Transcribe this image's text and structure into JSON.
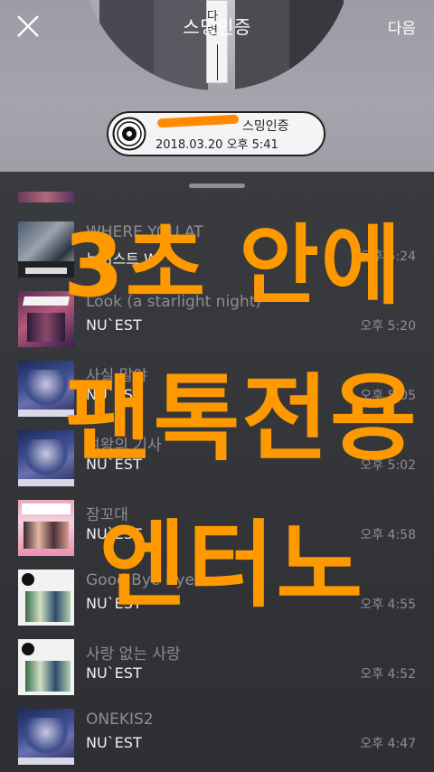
{
  "header": {
    "title": "스밍인증",
    "next_label": "다음",
    "close_icon": "close-icon",
    "cover_banner_text": "다 변"
  },
  "certificate": {
    "icon": "disc-icon",
    "name_suffix": "스밍인증",
    "datetime": "2018.03.20 오후 5:41",
    "redaction_color": "#ff8a00"
  },
  "songs": [
    {
      "title": "WHERE YOU AT",
      "artist": "뉴이스트 W",
      "time": "오후 5:24",
      "art": "art-where"
    },
    {
      "title": "Look (a starlight night)",
      "artist": "NU`EST",
      "time": "오후 5:20",
      "art": "art-nuest"
    },
    {
      "title": "사실 말야",
      "artist": "NU`EST",
      "time": "오후 5:05",
      "art": "art-blue"
    },
    {
      "title": "여왕의 기사",
      "artist": "NU`EST",
      "time": "오후 5:02",
      "art": "art-blue"
    },
    {
      "title": "잠꼬대",
      "artist": "NU`EST",
      "time": "오후 4:58",
      "art": "art-pink"
    },
    {
      "title": "Good Bye Bye",
      "artist": "NU`EST",
      "time": "오후 4:55",
      "art": "art-white"
    },
    {
      "title": "사랑 없는 사랑",
      "artist": "NU`EST",
      "time": "오후 4:52",
      "art": "art-white"
    },
    {
      "title": "ONEKIS2",
      "artist": "NU`EST",
      "time": "오후 4:47",
      "art": "art-blue"
    }
  ],
  "overlay": {
    "line1": "3초 안에",
    "line2": "팬톡전용",
    "line3": "엔터노",
    "color": "#ff9900"
  }
}
